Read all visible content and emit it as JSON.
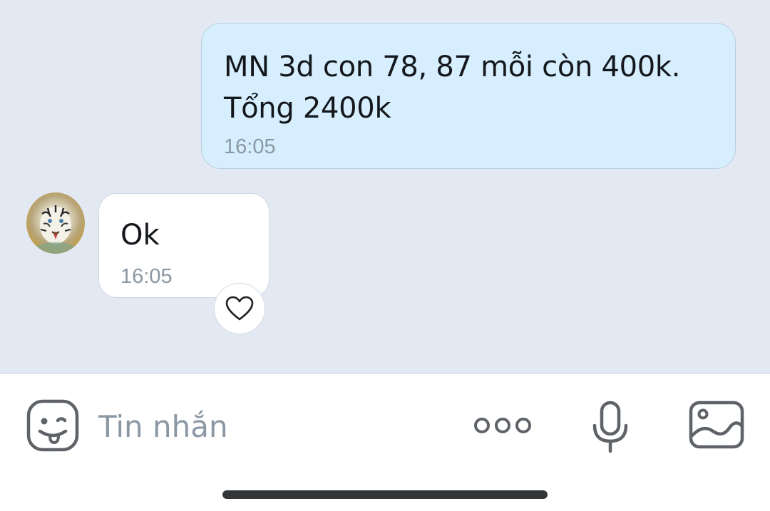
{
  "conversation": {
    "messages": [
      {
        "direction": "outgoing",
        "text": "MN 3d con 78, 87 mỗi còn 400k.\nTổng 2400k",
        "time": "16:05"
      },
      {
        "direction": "incoming",
        "text": "Ok",
        "time": "16:05",
        "reaction_icon": "heart-outline-icon"
      }
    ]
  },
  "composer": {
    "placeholder": "Tin nhắn",
    "value": "",
    "icons": {
      "sticker": "emoji-sticker-icon",
      "more": "more-options-icon",
      "mic": "microphone-icon",
      "image": "image-gallery-icon"
    }
  },
  "colors": {
    "chat_background": "#e3e9f2",
    "outgoing_bubble": "#d6eefd",
    "incoming_bubble": "#ffffff",
    "icon_gray": "#5f6368",
    "timestamp_gray": "#8b97a3"
  }
}
